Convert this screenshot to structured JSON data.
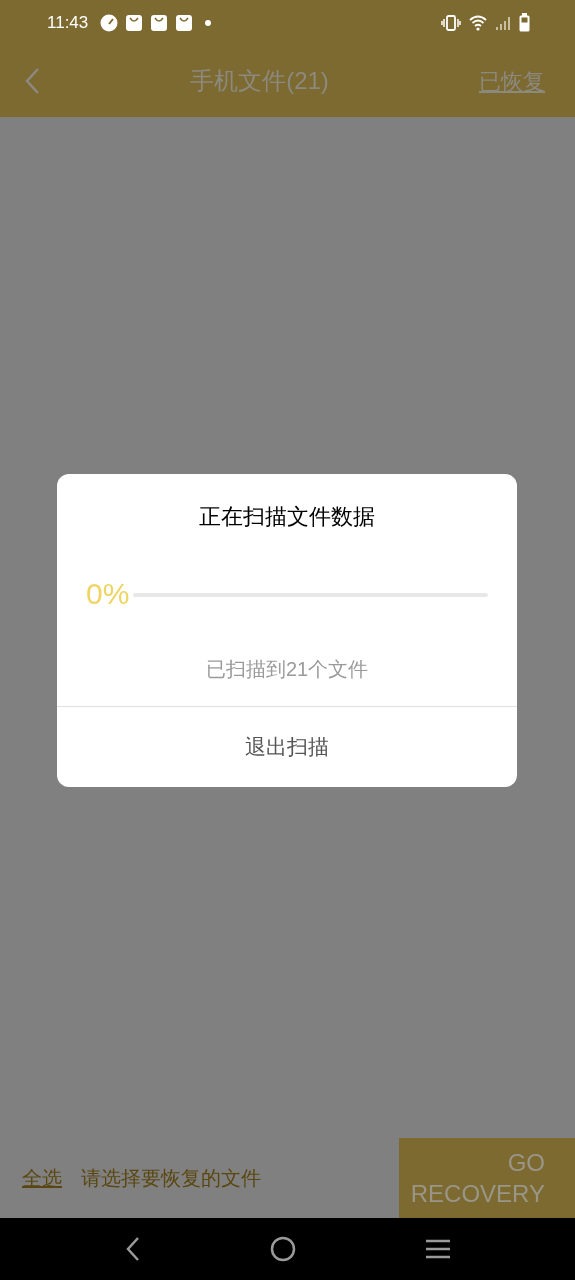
{
  "status_bar": {
    "time": "11:43"
  },
  "app_bar": {
    "title": "手机文件(21)",
    "action": "已恢复"
  },
  "bottom_bar": {
    "select_all": "全选",
    "hint": "请选择要恢复的文件",
    "button_line_1": "GO",
    "button_line_2": "RECOVERY"
  },
  "dialog": {
    "title": "正在扫描文件数据",
    "percent": "0%",
    "level": 0,
    "status": "已扫描到21个文件",
    "button": "退出扫描"
  }
}
